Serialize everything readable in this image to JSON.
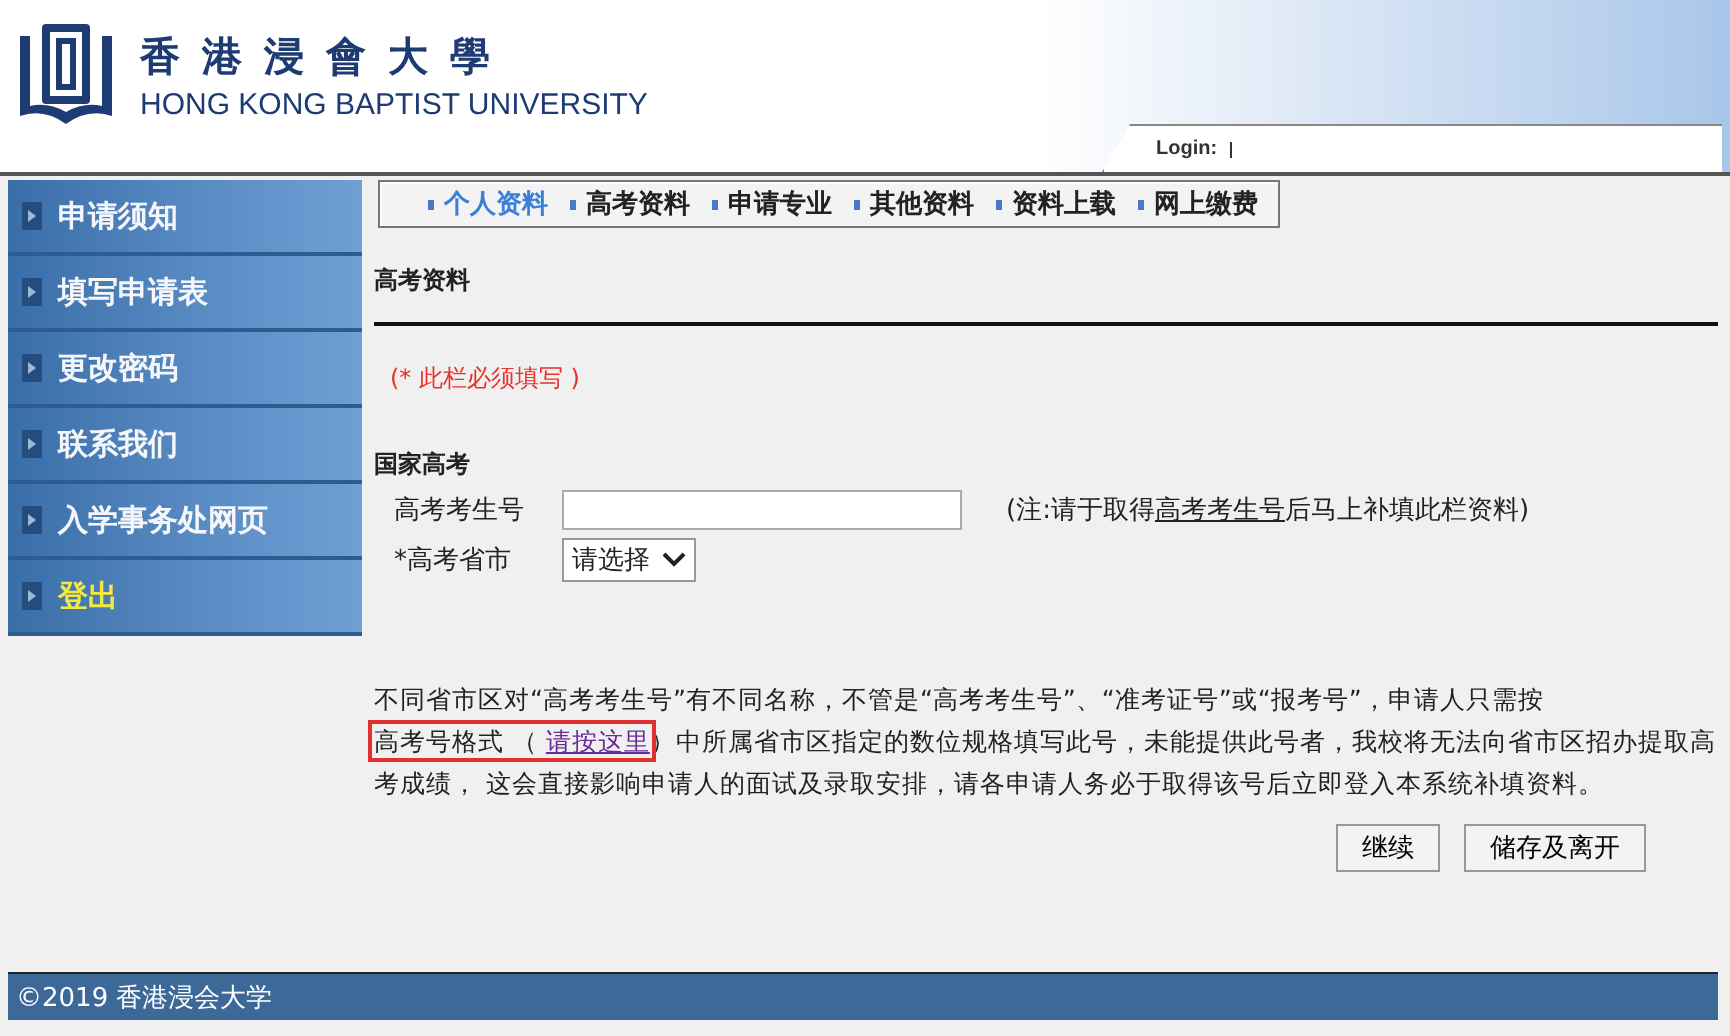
{
  "header": {
    "name_zh": "香 港 浸 會 大 學",
    "name_en": "HONG KONG BAPTIST UNIVERSITY",
    "login_label": "Login:"
  },
  "sidebar": {
    "items": [
      {
        "label": "申请须知",
        "kind": "link"
      },
      {
        "label": "填写申请表",
        "kind": "link"
      },
      {
        "label": "更改密码",
        "kind": "link"
      },
      {
        "label": "联系我们",
        "kind": "link"
      },
      {
        "label": "入学事务处网页",
        "kind": "link"
      },
      {
        "label": "登出",
        "kind": "logout"
      }
    ]
  },
  "tabs": [
    {
      "label": "个人资料",
      "selected": true
    },
    {
      "label": "高考资料",
      "selected": false
    },
    {
      "label": "申请专业",
      "selected": false
    },
    {
      "label": "其他资料",
      "selected": false
    },
    {
      "label": "资料上载",
      "selected": false
    },
    {
      "label": "网上缴费",
      "selected": false
    }
  ],
  "section_title": "高考资料",
  "required_note": "(* 此栏必须填写 )",
  "group_title": "国家高考",
  "fields": [
    {
      "label": "高考考生号",
      "kind": "text",
      "note_before": "(注:请于取得",
      "note_link": "高考考生号",
      "note_after": "后马上补填此栏资料)"
    },
    {
      "label": "*高考省市",
      "kind": "select",
      "value": "请选择"
    }
  ],
  "notice": {
    "before": "不同省市区对“高考考生号”有不同名称，不管是“高考考生号”、“准考证号”或“报考号”，申请人只需按",
    "framed": "高考号格式 （ ",
    "link": "请按这里",
    "after": "）中所属省市区指定的数位规格填写此号，未能提供此号者，我校将无法向省市区招办提取高考成绩， 这会直接影响申请人的面试及录取安排，请各申请人务必于取得该号后立即登入本系统补填资料。"
  },
  "buttons": [
    "继续",
    "储存及离开"
  ],
  "footer": "©2019 香港浸会大学"
}
